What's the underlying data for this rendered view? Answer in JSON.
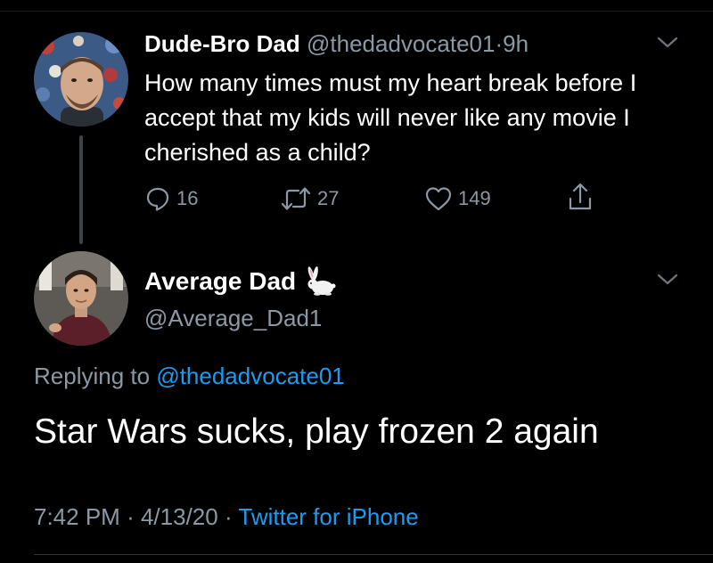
{
  "tweet1": {
    "display_name": "Dude-Bro Dad",
    "handle": "@thedadvocate01",
    "separator": "·",
    "time": "9h",
    "text": "How many times must my heart break before I accept that my kids will never like any movie I cherished as a child?",
    "replies": "16",
    "retweets": "27",
    "likes": "149"
  },
  "tweet2": {
    "display_name": "Average Dad",
    "name_emoji": "rabbit-icon",
    "handle": "@Average_Dad1",
    "replying_prefix": "Replying to ",
    "replying_to": "@thedadvocate01",
    "text": "Star Wars sucks, play frozen 2 again",
    "time": "7:42 PM",
    "date": "4/13/20",
    "separator": "·",
    "source": "Twitter for iPhone"
  },
  "icons": {
    "reply": "comment-bubble-icon",
    "retweet": "retweet-arrows-icon",
    "like": "heart-icon",
    "share": "share-upload-icon",
    "more": "chevron-down-icon"
  },
  "colors": {
    "background": "#000000",
    "text": "#ffffff",
    "secondary": "#8b98a5",
    "link": "#1d9bf0"
  }
}
